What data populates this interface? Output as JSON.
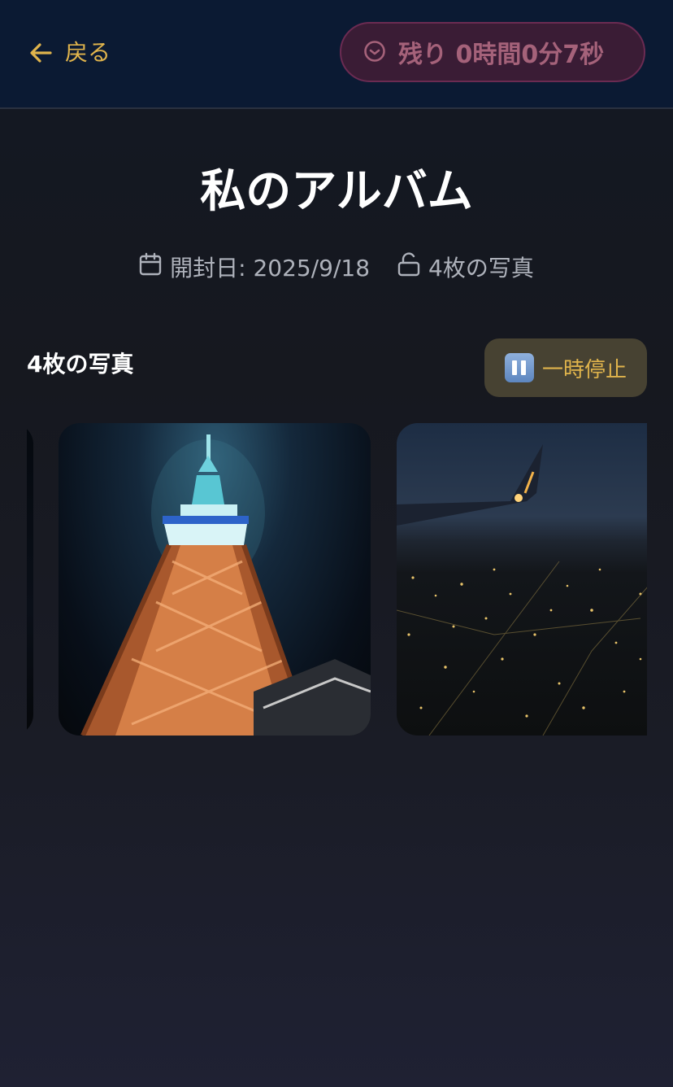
{
  "header": {
    "back_label": "戻る",
    "timer_label": "残り 0時間0分7秒",
    "back_icon": "arrow-left-icon",
    "timer_icon": "clock-icon"
  },
  "album": {
    "title": "私のアルバム",
    "opened_date": "開封日: 2025/9/18",
    "photo_count": "4枚の写真"
  },
  "section": {
    "title": "4枚の写真",
    "pause_label": "一時停止"
  },
  "colors": {
    "accent": "#e0b44c",
    "header_bg": "#0b1a33",
    "timer_bg": "#3a1c35",
    "timer_text": "#a5627a"
  }
}
